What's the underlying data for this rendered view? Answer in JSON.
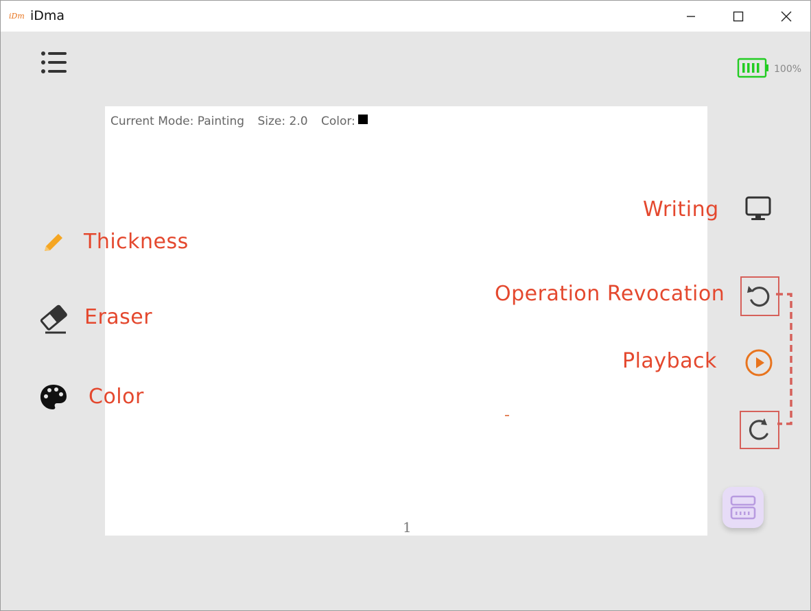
{
  "window": {
    "title": "iDma",
    "logo_text": "iDm"
  },
  "header": {
    "battery_percent": "100%",
    "battery_level": 1.0,
    "battery_color": "#22cc22"
  },
  "canvas": {
    "status": {
      "mode": "Current Mode: Painting",
      "size": "Size: 2.0",
      "color_label": "Color:",
      "color_value": "#000000"
    },
    "page_number": "1"
  },
  "tools": {
    "thickness_label": "Thickness",
    "eraser_label": "Eraser",
    "color_label": "Color",
    "writing_label": "Writing",
    "revocation_label": "Operation Revocation",
    "playback_label": "Playback"
  },
  "colors": {
    "annotation": "#e4482e",
    "annotation_box": "#d6605a",
    "pencil": "#f5a623",
    "playback": "#e8741e",
    "keyboard_bg": "#e7dcf7"
  },
  "icons": {
    "menu": "menu-icon",
    "battery": "battery-icon",
    "pencil": "pencil-icon",
    "eraser": "eraser-icon",
    "palette": "palette-icon",
    "monitor": "monitor-icon",
    "undo": "undo-icon",
    "play": "play-icon",
    "redo": "redo-icon",
    "keyboard": "keyboard-icon"
  }
}
